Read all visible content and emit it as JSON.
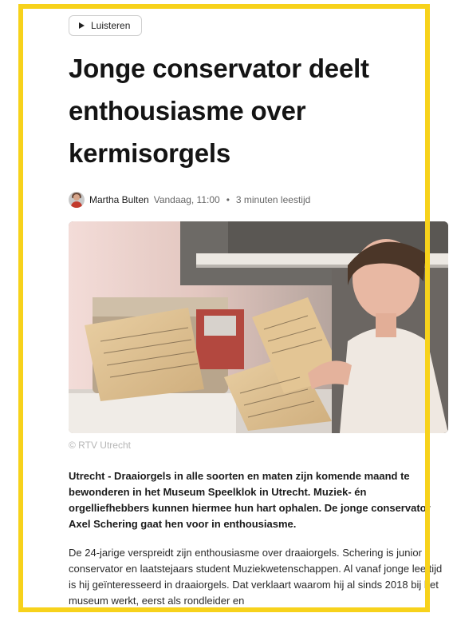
{
  "listen_button": {
    "label": "Luisteren",
    "icon": "play-icon"
  },
  "article": {
    "title": "Jonge conservator deelt enthousiasme over kermisorgels",
    "author": "Martha Bulten",
    "date": "Vandaag, 11:00",
    "separator": "•",
    "reading_time": "3 minuten leestijd",
    "photo_caption": "© RTV Utrecht",
    "lead": "Utrecht - Draaiorgels in alle soorten en maten zijn komende maand te bewonderen in het Museum Speelklok in Utrecht. Muziek- én orgelliefhebbers kunnen hiermee hun hart ophalen. De jonge conservator Axel Schering gaat hen voor in enthousiasme.",
    "body": "De 24-jarige verspreidt zijn enthousiasme over draaiorgels. Schering is junior conservator en laatstejaars student Muziekwetenschappen. Al vanaf jonge leeftijd is hij geïnteresseerd in draaiorgels. Dat verklaart waarom hij al sinds 2018 bij het museum werkt, eerst als rondleider en"
  },
  "colors": {
    "frame": "#f7d21b",
    "title": "#141414"
  }
}
